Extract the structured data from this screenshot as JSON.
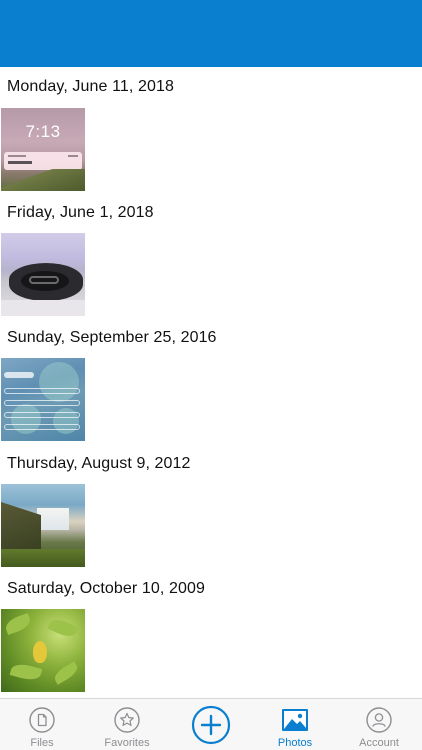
{
  "header": {
    "background_color": "#0a7fd0"
  },
  "photos": {
    "groups": [
      {
        "date": "Monday, June 11, 2018",
        "thumbnail_lockscreen_time": "7:13"
      },
      {
        "date": "Friday, June 1, 2018"
      },
      {
        "date": "Sunday, September 25, 2016"
      },
      {
        "date": "Thursday, August 9, 2012"
      },
      {
        "date": "Saturday, October 10, 2009"
      }
    ]
  },
  "tabbar": {
    "active_color": "#0a7fd0",
    "inactive_color": "#8e8e93",
    "tabs": [
      {
        "label": "Files",
        "icon": "file-icon"
      },
      {
        "label": "Favorites",
        "icon": "star-icon"
      },
      {
        "label": "",
        "icon": "add-icon"
      },
      {
        "label": "Photos",
        "icon": "photos-icon",
        "active": true
      },
      {
        "label": "Account",
        "icon": "account-icon"
      }
    ]
  }
}
